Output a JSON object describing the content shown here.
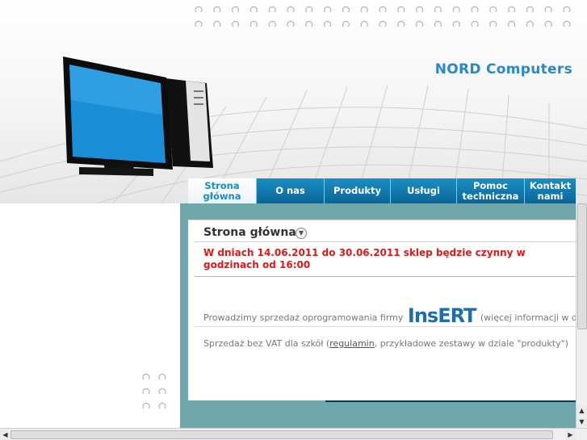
{
  "header": {
    "brand": "NORD Computers"
  },
  "nav": {
    "items": [
      {
        "label": "Strona\ngłówna",
        "active": true
      },
      {
        "label": "O nas",
        "active": false
      },
      {
        "label": "Produkty",
        "active": false
      },
      {
        "label": "Usługi",
        "active": false
      },
      {
        "label": "Pomoc\ntechniczna",
        "active": false
      },
      {
        "label": "Kontakt\nnami",
        "active": false
      }
    ]
  },
  "content": {
    "title": "Strona główna",
    "notice": "W dniach 14.06.2011 do 30.06.2011 sklep będzie czynny w godzinach od 16:00",
    "insert_line": {
      "before": "Prowadzimy sprzedaż oprogramowania firmy",
      "logo": "InsERT",
      "after": "(więcej informacji w dzia"
    },
    "vat_line": {
      "before": "Sprzedaż bez VAT dla szkół (",
      "link": "regulamin",
      "after": ", przykładowe zestawy w dziale \"produkty\")"
    }
  },
  "colors": {
    "brand": "#2a88c6",
    "nav_bg": "#0a6598",
    "notice": "#e01818",
    "content_bg": "#6ea8ac"
  },
  "icons": {
    "collapse": "chevron-down-icon",
    "computer": "computer-illustration",
    "scroll_up": "arrow-up-icon",
    "scroll_down": "arrow-down-icon",
    "scroll_left": "arrow-left-icon",
    "scroll_right": "arrow-right-icon"
  }
}
